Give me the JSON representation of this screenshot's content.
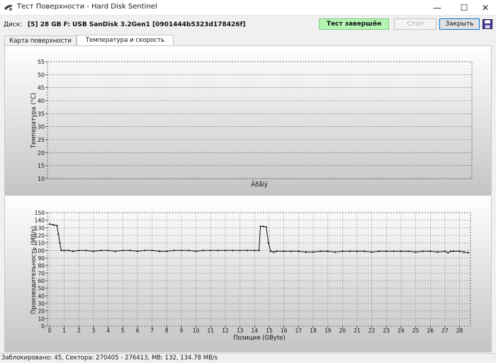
{
  "window": {
    "title": "Тест Поверхности - Hard Disk Sentinel",
    "minimize_glyph": "—",
    "maximize_glyph": "☐",
    "close_glyph": "✕"
  },
  "disk": {
    "label": "Диск:",
    "value": "[5] 28 GB F: USB SanDisk 3.2Gen1 [0901444b5323d178426f]"
  },
  "toolbar": {
    "status": "Тест завершён",
    "stop_label": "Стоп",
    "close_label": "Закрыть"
  },
  "tabs": [
    {
      "label": "Карта поверхности диска"
    },
    {
      "label": "Температура и скорость передачи"
    }
  ],
  "icons": {
    "app": "sentinel-app-icon",
    "help": "floppy-save-icon",
    "save": "floppy-save-icon"
  },
  "colors": {
    "status_bg": "#b4f5b4",
    "accent": "#0078d7",
    "save_icon": "#4a2e8e",
    "plot_top": "#ffffff",
    "plot_bottom": "#c4c4c4"
  },
  "chart_data": [
    {
      "type": "line",
      "ylabel": "Температура (°C)",
      "xlabel": "Âðåìÿ",
      "ylim": [
        10,
        55
      ],
      "yticks": [
        "55",
        "50",
        "45",
        "40",
        "35",
        "30",
        "25",
        "20",
        "15",
        "10"
      ],
      "grid": "horizontal-dashed",
      "series": []
    },
    {
      "type": "line",
      "ylabel": "Производительность (MB/s)",
      "xlabel": "Позиция (GByte)",
      "ylim": [
        0,
        150
      ],
      "xlim": [
        0,
        28.6
      ],
      "yticks": [
        "150",
        "140",
        "130",
        "120",
        "110",
        "100",
        "90",
        "80",
        "70",
        "60",
        "50",
        "40",
        "30",
        "20",
        "10",
        "0"
      ],
      "xticks": [
        "0",
        "1",
        "2",
        "3",
        "4",
        "5",
        "6",
        "7",
        "8",
        "9",
        "10",
        "11",
        "12",
        "13",
        "14",
        "15",
        "16",
        "17",
        "18",
        "19",
        "20",
        "21",
        "22",
        "23",
        "24",
        "25",
        "26",
        "27",
        "28"
      ],
      "grid": "both-dashed",
      "series": [
        {
          "x": [
            0,
            0.25,
            0.5,
            0.6,
            0.7,
            0.8,
            1.0,
            1.3,
            1.6,
            2,
            2.5,
            3,
            3.5,
            4,
            4.5,
            5,
            5.5,
            6,
            6.5,
            7,
            7.5,
            8,
            8.5,
            9,
            9.5,
            10,
            10.5,
            11,
            11.5,
            12,
            12.5,
            13,
            13.5,
            14,
            14.3,
            14.4,
            14.6,
            14.8,
            14.95,
            15.1,
            15.3,
            15.5,
            16,
            16.5,
            17,
            17.5,
            18,
            18.5,
            19,
            19.5,
            20,
            20.5,
            21,
            21.5,
            22,
            22.5,
            23,
            23.5,
            24,
            24.5,
            25,
            25.5,
            26,
            26.5,
            27,
            27.2,
            27.4,
            27.6,
            28,
            28.3,
            28.6
          ],
          "values": [
            135,
            134,
            133,
            122,
            110,
            100,
            100,
            100,
            99,
            100,
            100,
            99,
            100,
            100,
            99,
            100,
            100,
            99,
            100,
            100,
            99,
            99,
            100,
            100,
            100,
            99,
            100,
            100,
            100,
            100,
            100,
            100,
            100,
            100,
            100,
            132,
            132,
            131,
            110,
            99,
            98,
            99,
            99,
            99,
            99,
            98,
            98,
            99,
            99,
            98,
            99,
            99,
            99,
            99,
            98,
            99,
            99,
            99,
            99,
            99,
            98,
            99,
            99,
            98,
            99,
            97,
            99,
            99,
            99,
            98,
            97
          ]
        }
      ]
    }
  ],
  "statusbar": {
    "text": "Заблокировано: 45, Сектора: 270405 - 276413, MB: 132, 134.78 MB/s"
  }
}
